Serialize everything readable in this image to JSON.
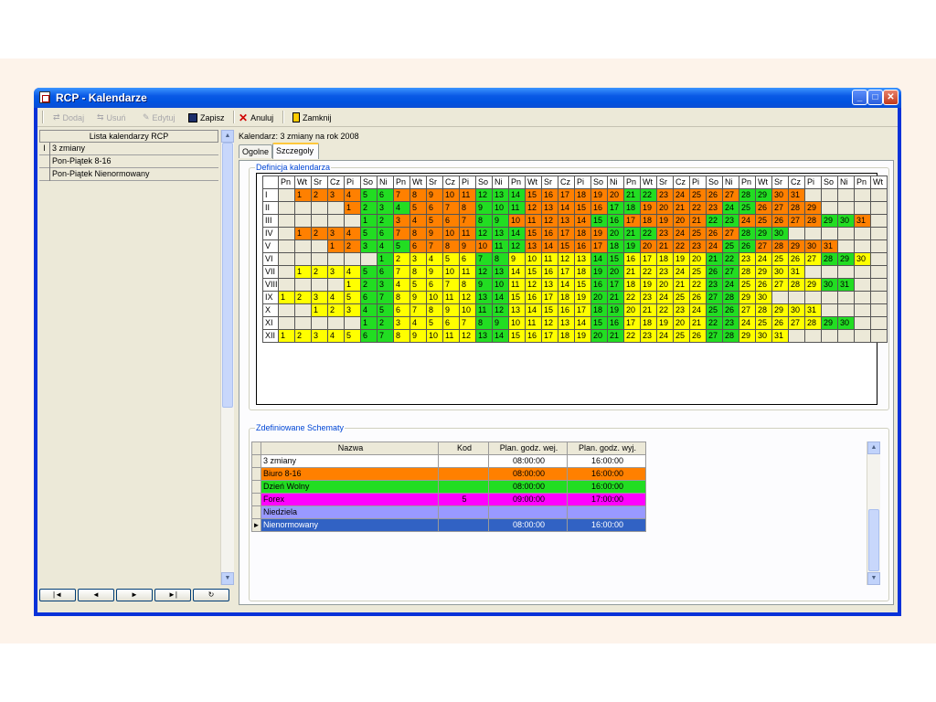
{
  "window": {
    "title": "RCP - Kalendarze"
  },
  "toolbar": {
    "add": "Dodaj",
    "remove": "Usuń",
    "edit": "Edytuj",
    "save": "Zapisz",
    "cancel": "Anuluj",
    "close": "Zamknij"
  },
  "list": {
    "header": "Lista kalendarzy RCP",
    "items": [
      "3 zmiany",
      "Pon-Piątek 8-16",
      "Pon-Piątek Nienormowany"
    ]
  },
  "nav": [
    "|◄",
    "◄",
    "►",
    "►|",
    "↻"
  ],
  "calendar": {
    "header": "Kalendarz: 3 zmiany na rok 2008",
    "tabs": [
      "Ogolne",
      "Szczegoly"
    ],
    "definition_label": "Definicja kalendarza",
    "weekdays": [
      "Pn",
      "Wt",
      "Sr",
      "Cz",
      "Pi",
      "So",
      "Ni",
      "Pn",
      "Wt",
      "Sr",
      "Cz",
      "Pi",
      "So",
      "Ni",
      "Pn",
      "Wt",
      "Sr",
      "Cz",
      "Pi",
      "So",
      "Ni",
      "Pn",
      "Wt",
      "Sr",
      "Cz",
      "Pi",
      "So",
      "Ni",
      "Pn",
      "Wt",
      "Sr",
      "Cz",
      "Pi",
      "So",
      "Ni",
      "Pn",
      "Wt"
    ],
    "months": [
      {
        "name": "I",
        "offset": 1,
        "days": 31,
        "colors": "ooooggooooogggooooooggoooooggoooo"
      },
      {
        "name": "II",
        "offset": 4,
        "days": 29,
        "colors": "ogggoooogggoooooggoooooggooooo"
      },
      {
        "name": "III",
        "offset": 5,
        "days": 31,
        "colors": "ggoooooggoooooggoooooggoooooggoo"
      },
      {
        "name": "IV",
        "offset": 1,
        "days": 30,
        "colors": "ooooggooooogggooooogggooooogggoo"
      },
      {
        "name": "V",
        "offset": 3,
        "days": 31,
        "colors": "oogggoooooggoooooggoooooggoooooggg"
      },
      {
        "name": "VI",
        "offset": 6,
        "days": 30,
        "colors": "gyyyyyggyyyyyggyyyyyggyyyyyggy"
      },
      {
        "name": "VII",
        "offset": 1,
        "days": 31,
        "colors": "yyyyggyyyyyggyyyyyggyyyyyggyyyyy"
      },
      {
        "name": "VIII",
        "offset": 4,
        "days": 31,
        "colors": "yggyyyyyggyyyyyggyyyyyggyyyyyggg"
      },
      {
        "name": "IX",
        "offset": 0,
        "days": 30,
        "colors": "yyyyyggyyyyyggyyyyyggyyyyyggyy"
      },
      {
        "name": "X",
        "offset": 2,
        "days": 31,
        "colors": "yyyggyyyyyggyyyyyggyyyyyggyyyyy"
      },
      {
        "name": "XI",
        "offset": 5,
        "days": 30,
        "colors": "ggyyyyyggyyyyyggyyyyyggyyyyygg"
      },
      {
        "name": "XII",
        "offset": 0,
        "days": 31,
        "colors": "yyyyyggyyyyyggyyyyyggyyyyyggyyy"
      }
    ],
    "color_map": {
      "o": "#ff8000",
      "y": "#ffff00",
      "g": "#22dd22"
    }
  },
  "schemes": {
    "label": "Zdefiniowane Schematy",
    "columns": [
      "Nazwa",
      "Kod",
      "Plan. godz. wej.",
      "Plan. godz. wyj."
    ],
    "rows": [
      {
        "name": "3 zmiany",
        "code": "",
        "in": "08:00:00",
        "out": "16:00:00",
        "bg": "#ffffff",
        "fg": "#000000"
      },
      {
        "name": "Biuro 8-16",
        "code": "",
        "in": "08:00:00",
        "out": "16:00:00",
        "bg": "#ff8000",
        "fg": "#000000"
      },
      {
        "name": "Dzień Wolny",
        "code": "",
        "in": "08:00:00",
        "out": "16:00:00",
        "bg": "#22dd22",
        "fg": "#000000"
      },
      {
        "name": "Forex",
        "code": "5",
        "in": "09:00:00",
        "out": "17:00:00",
        "bg": "#ff00ff",
        "fg": "#000000"
      },
      {
        "name": "Niedziela",
        "code": "",
        "in": "",
        "out": "",
        "bg": "#9999ff",
        "fg": "#000000"
      },
      {
        "name": "Nienormowany",
        "code": "",
        "in": "08:00:00",
        "out": "16:00:00",
        "bg": "#3162c4",
        "fg": "#ffffff"
      }
    ]
  }
}
